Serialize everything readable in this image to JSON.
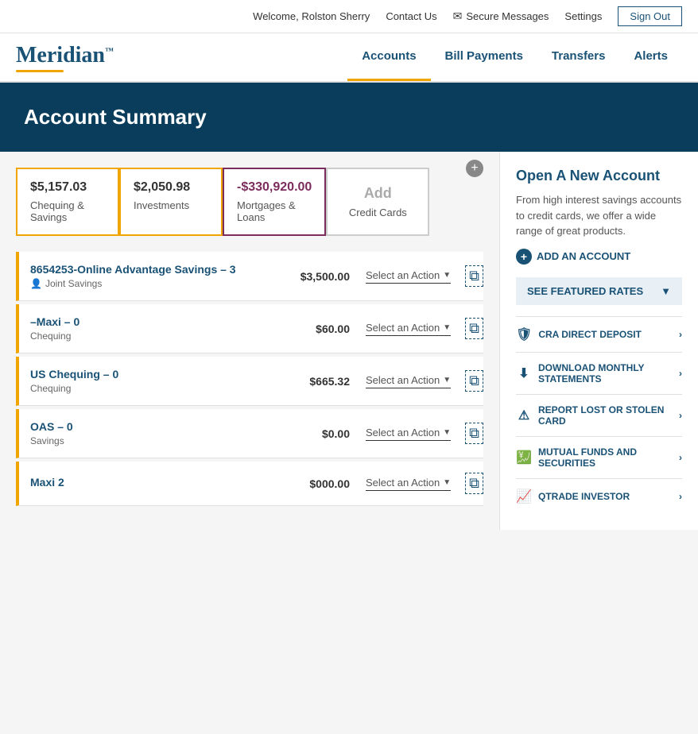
{
  "topbar": {
    "welcome": "Welcome, Rolston Sherry",
    "contact_us": "Contact Us",
    "secure_messages": "Secure Messages",
    "settings": "Settings",
    "sign_out": "Sign Out"
  },
  "logo": {
    "text": "Meridian",
    "tm": "™"
  },
  "nav": {
    "items": [
      {
        "label": "Accounts",
        "active": true
      },
      {
        "label": "Bill Payments",
        "active": false
      },
      {
        "label": "Transfers",
        "active": false
      },
      {
        "label": "Alerts",
        "active": false
      }
    ]
  },
  "banner": {
    "title": "Account Summary"
  },
  "tiles": [
    {
      "amount": "$5,157.03",
      "label": "Chequing & Savings",
      "type": "gold"
    },
    {
      "amount": "$2,050.98",
      "label": "Investments",
      "type": "gold"
    },
    {
      "amount": "-$330,920.00",
      "label": "Mortgages & Loans",
      "type": "mortgage"
    },
    {
      "label": "Add",
      "sublabel": "Credit Cards",
      "type": "add"
    }
  ],
  "accounts": [
    {
      "name": "8654253-Online Advantage Savings – 3",
      "type": "Joint Savings",
      "balance": "$3,500.00",
      "action": "Select an Action"
    },
    {
      "name": "–Maxi – 0",
      "type": "Chequing",
      "balance": "$60.00",
      "action": "Select an Action"
    },
    {
      "name": "US Chequing – 0",
      "type": "Chequing",
      "balance": "$665.32",
      "action": "Select an Action"
    },
    {
      "name": "OAS – 0",
      "type": "Savings",
      "balance": "$0.00",
      "action": "Select an Action"
    },
    {
      "name": "Maxi 2",
      "type": "",
      "balance": "$000.00",
      "action": "Select an Action"
    }
  ],
  "right_panel": {
    "open_account_title": "Open A New Account",
    "open_account_desc": "From high interest savings accounts to credit cards, we offer a wide range of great products.",
    "add_account_label": "ADD AN ACCOUNT",
    "featured_rates_label": "SEE FEATURED RATES",
    "links": [
      {
        "label": "CRA DIRECT DEPOSIT",
        "icon": "shield"
      },
      {
        "label": "DOWNLOAD MONTHLY STATEMENTS",
        "icon": "download"
      },
      {
        "label": "REPORT LOST OR STOLEN CARD",
        "icon": "alert"
      },
      {
        "label": "MUTUAL FUNDS AND SECURITIES",
        "icon": "chart"
      },
      {
        "label": "QTRADE INVESTOR",
        "icon": "graph"
      }
    ]
  }
}
